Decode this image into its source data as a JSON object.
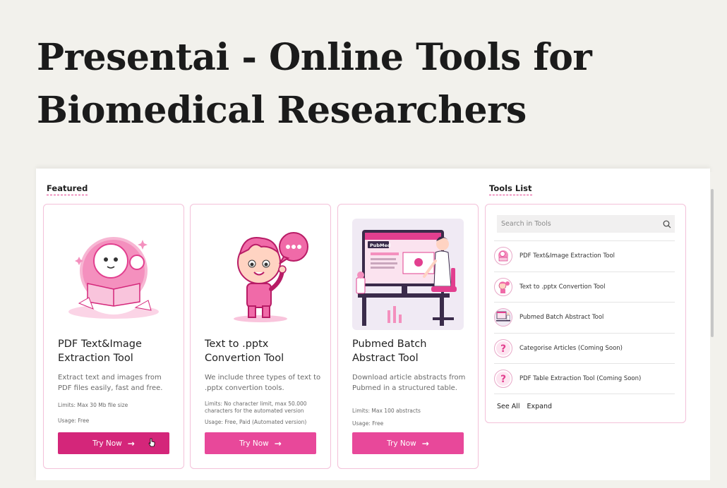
{
  "page": {
    "title": "Presentai - Online Tools for Biomedical Researchers"
  },
  "featured": {
    "label": "Featured",
    "cards": [
      {
        "title": "PDF Text&Image Extraction Tool",
        "description": "Extract text and images from PDF files easily, fast and free.",
        "limits": "Limits: Max 30 Mb file size",
        "usage": "Usage: Free",
        "button_label": "Try Now",
        "image": "reading-robot-illustration"
      },
      {
        "title": "Text to .pptx Convertion Tool",
        "description": "We include three types of text to .pptx convertion tools.",
        "limits": "Limits: No character limit, max 50.000 characters for the automated version",
        "usage": "Usage: Free, Paid (Automated version)",
        "button_label": "Try Now",
        "image": "cartoon-boy-speech-bubble-illustration"
      },
      {
        "title": "Pubmed Batch Abstract Tool",
        "description": "Download article abstracts from Pubmed in a structured table.",
        "limits": "Limits: Max 100 abstracts",
        "usage": "Usage: Free",
        "button_label": "Try Now",
        "image": "researcher-at-pubmed-desk-illustration",
        "image_text": "PubMed"
      }
    ]
  },
  "tools": {
    "label": "Tools List",
    "search_placeholder": "Search in Tools",
    "items": [
      {
        "name": "PDF Text&Image Extraction Tool",
        "icon": "robot-thumbnail"
      },
      {
        "name": "Text to .pptx Convertion Tool",
        "icon": "boy-thumbnail"
      },
      {
        "name": "Pubmed Batch Abstract Tool",
        "icon": "desk-thumbnail"
      },
      {
        "name": "Categorise Articles (Coming Soon)",
        "icon": "question-mark-icon"
      },
      {
        "name": "PDF Table Extraction Tool (Coming Soon)",
        "icon": "question-mark-icon"
      }
    ],
    "see_all_label": "See All",
    "expand_label": "Expand"
  },
  "colors": {
    "accent": "#e8489a",
    "accent_active": "#d4267a",
    "background": "#f2f1ec",
    "card_border": "#f3c1d9"
  }
}
